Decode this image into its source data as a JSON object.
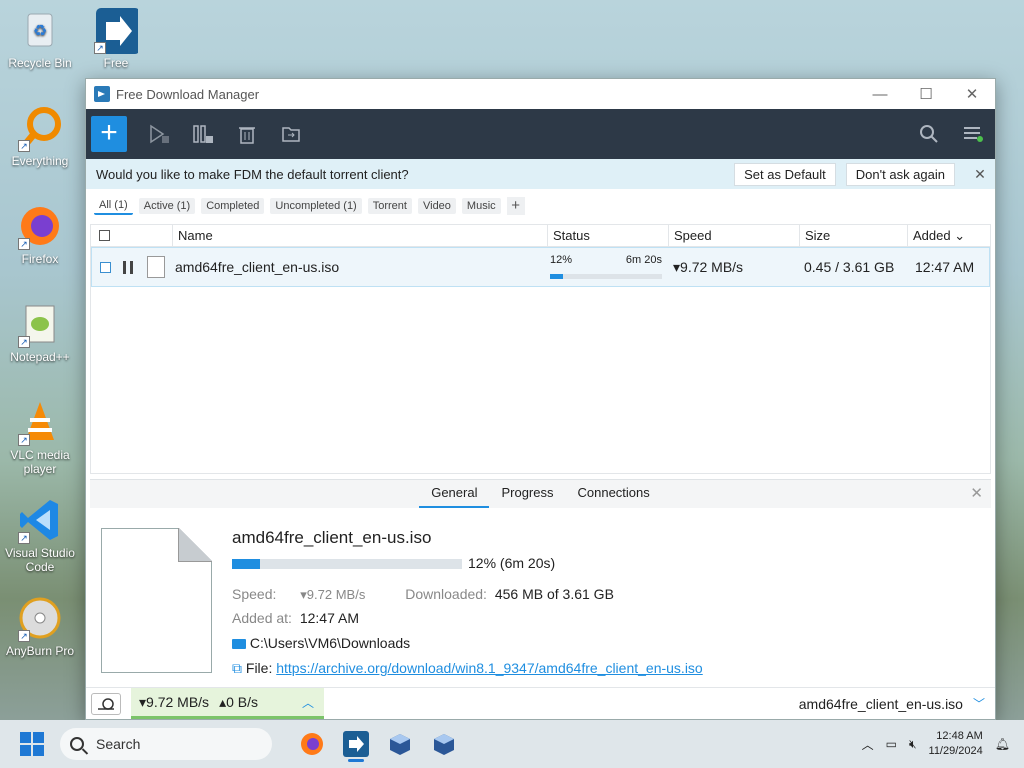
{
  "desktop": {
    "icons": [
      {
        "label": "Recycle Bin"
      },
      {
        "label": "Free"
      },
      {
        "label": "Everything"
      },
      {
        "label": "Firefox"
      },
      {
        "label": "Notepad++"
      },
      {
        "label": "VLC media player"
      },
      {
        "label": "Visual Studio Code"
      },
      {
        "label": "AnyBurn Pro"
      }
    ]
  },
  "window": {
    "title": "Free Download Manager",
    "minimize": "—",
    "maximize": "☐",
    "close": "✕"
  },
  "banner": {
    "message": "Would you like to make FDM the default torrent client?",
    "set_default": "Set as Default",
    "dont_ask": "Don't ask again",
    "close": "✕"
  },
  "filters": [
    "All (1)",
    "Active (1)",
    "Completed",
    "Uncompleted (1)",
    "Torrent",
    "Video",
    "Music"
  ],
  "table": {
    "headers": {
      "name": "Name",
      "status": "Status",
      "speed": "Speed",
      "size": "Size",
      "added": "Added ⌄"
    },
    "rows": [
      {
        "name": "amd64fre_client_en-us.iso",
        "percent": "12%",
        "eta": "6m 20s",
        "progress": 0.12,
        "speed": "▾9.72 MB/s",
        "size": "0.45 / 3.61 GB",
        "added": "12:47 AM"
      }
    ]
  },
  "details": {
    "tabs": [
      "General",
      "Progress",
      "Connections"
    ],
    "name": "amd64fre_client_en-us.iso",
    "progress": 0.12,
    "progress_text": "12% (6m 20s)",
    "speed_label": "Speed:",
    "speed_value": "▾9.72 MB/s",
    "downloaded_label": "Downloaded:",
    "downloaded_value": "456 MB of 3.61 GB",
    "added_label": "Added at:",
    "added_value": "12:47 AM",
    "folder": "C:\\Users\\VM6\\Downloads",
    "file_label": "File:",
    "file_url": "https://archive.org/download/win8.1_9347/amd64fre_client_en-us.iso"
  },
  "statusbar": {
    "down_speed": "▾9.72 MB/s",
    "up_speed": "▴0 B/s",
    "current_file": "amd64fre_client_en-us.iso"
  },
  "taskbar": {
    "search_placeholder": "Search",
    "time": "12:48 AM",
    "date": "11/29/2024"
  },
  "colors": {
    "accent": "#1f8ee0",
    "toolbar": "#2d3947",
    "banner": "#dff0f7"
  }
}
